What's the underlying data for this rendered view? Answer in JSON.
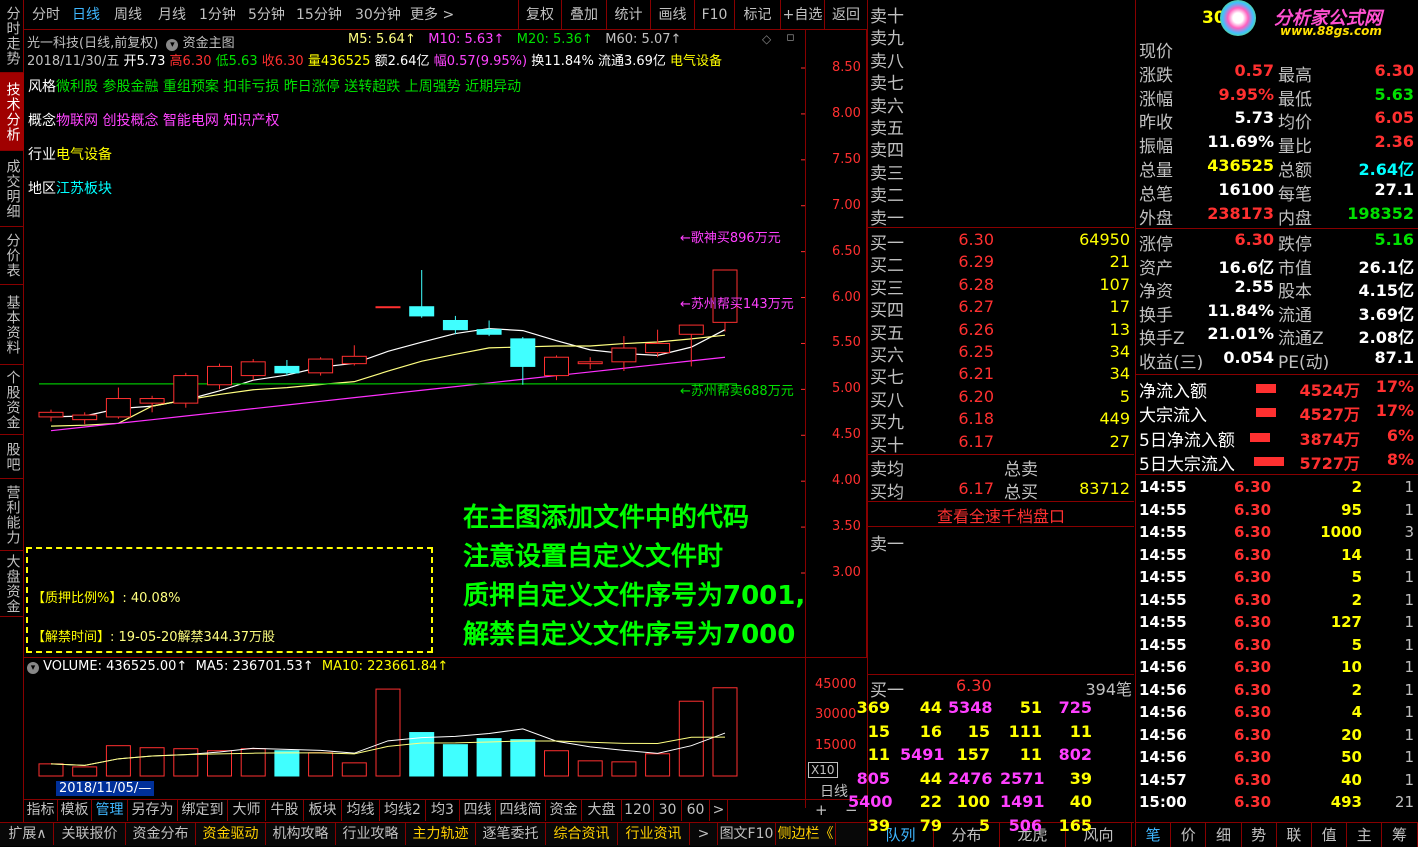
{
  "left_tabs": [
    "分时走势",
    "技术分析",
    "成交明细",
    "分价表",
    "基本资料",
    "个股资金",
    "股吧",
    "营利能力",
    "大盘资金"
  ],
  "period_tabs": [
    "分时",
    "日线",
    "周线",
    "月线",
    "1分钟",
    "5分钟",
    "15分钟",
    "30分钟",
    "更多 >"
  ],
  "toolbar": [
    "复权",
    "叠加",
    "统计",
    "画线",
    "F10",
    "标记",
    "+自选",
    "返回"
  ],
  "header": {
    "title": "光一科技(日线,前复权)",
    "indicator": "资金主图",
    "ma5": "M5: 5.64↑",
    "ma10": "M10: 5.63↑",
    "ma20": "M20: 5.36↑",
    "ma60": "M60: 5.07↑",
    "info_date": "2018/11/30/五",
    "info_open": "开5.73",
    "info_high": "高6.30",
    "info_low": "低5.63",
    "info_close": "收6.30",
    "info_vol": "量436525",
    "info_amt": "额2.64亿",
    "info_chg": "幅0.57(9.95%)",
    "info_turn": "换11.84%",
    "info_float": "流通3.69亿",
    "info_ind": "电气设备"
  },
  "tags": {
    "style_label": "风格",
    "style_value": "微利股 参股金融 重组预案 扣非亏损 昨日涨停 送转超跌 上周强势 近期异动",
    "concept_label": "概念",
    "concept_value": "物联网 创投概念 智能电网 知识产权",
    "industry_label": "行业",
    "industry_value": "电气设备",
    "region_label": "地区",
    "region_value": "江苏板块"
  },
  "price_axis": [
    "8.50",
    "8.00",
    "7.50",
    "7.00",
    "6.50",
    "6.00",
    "5.50",
    "5.00",
    "4.50",
    "4.00",
    "3.50",
    "3.00"
  ],
  "chart_labels": {
    "buy1": "←歌神买896万元",
    "buy2": "←苏州帮买143万元",
    "sell1": "←苏州帮卖688万元"
  },
  "pledge_box": {
    "line1_label": "【质押比例%】",
    "line1_value": ": 40.08%",
    "line2_label": "【解禁时间】",
    "line2_value": ": 19-05-20解禁344.37万股"
  },
  "annotation": [
    "在主图添加文件中的代码",
    "注意设置自定义文件时",
    "质押自定义文件序号为7001,",
    "解禁自定义文件序号为7000"
  ],
  "volume_header": {
    "vol": "VOLUME: 436525.00↑",
    "ma5": "MA5: 236701.53↑",
    "ma10": "MA10: 223661.84↑"
  },
  "volume_axis": [
    "45000",
    "30000",
    "15000"
  ],
  "vol_unit": "X10",
  "date_marker": "2018/11/05/—",
  "bottom_tabs": [
    "指标",
    "模板",
    "管理",
    "另存为",
    "绑定到",
    "大师",
    "牛股",
    "板块",
    "均线",
    "均线2",
    "均3",
    "四线",
    "四线简",
    "资金",
    "大盘",
    "120",
    "30",
    "60",
    ">"
  ],
  "day_label": "日线",
  "bottom_bar": [
    "扩展∧",
    "关联报价",
    "资金分布",
    "资金驱动",
    "机构攻略",
    "行业攻略",
    "主力轨迹",
    "逐笔委托",
    "综合资讯",
    "行业资讯",
    ">",
    "图文F10",
    "侧边栏《"
  ],
  "sells": [
    "卖十",
    "卖九",
    "卖八",
    "卖七",
    "卖六",
    "卖五",
    "卖四",
    "卖三",
    "卖二",
    "卖一"
  ],
  "buys": [
    {
      "l": "买一",
      "p": "6.30",
      "v": "64950"
    },
    {
      "l": "买二",
      "p": "6.29",
      "v": "21"
    },
    {
      "l": "买三",
      "p": "6.28",
      "v": "107"
    },
    {
      "l": "买四",
      "p": "6.27",
      "v": "17"
    },
    {
      "l": "买五",
      "p": "6.26",
      "v": "13"
    },
    {
      "l": "买六",
      "p": "6.25",
      "v": "34"
    },
    {
      "l": "买七",
      "p": "6.21",
      "v": "34"
    },
    {
      "l": "买八",
      "p": "6.20",
      "v": "5"
    },
    {
      "l": "买九",
      "p": "6.18",
      "v": "449"
    },
    {
      "l": "买十",
      "p": "6.17",
      "v": "27"
    }
  ],
  "avg": {
    "sell_avg": "卖均",
    "sell_total": "总卖",
    "buy_avg": "买均",
    "buy_avg_p": "6.17",
    "buy_total": "总买",
    "buy_total_v": "83712"
  },
  "view_all": "查看全速千档盘口",
  "sell1_label": "卖一",
  "buy1_row": {
    "l": "买一",
    "p": "6.30",
    "v": "394笔"
  },
  "queue": [
    [
      "369",
      "44",
      "5348",
      "51",
      "725"
    ],
    [
      "15",
      "16",
      "15",
      "111",
      "11"
    ],
    [
      "11",
      "5491",
      "157",
      "11",
      "802"
    ],
    [
      "805",
      "44",
      "2476",
      "2571",
      "39"
    ],
    [
      "5400",
      "22",
      "100",
      "1491",
      "40"
    ],
    [
      "39",
      "79",
      "5",
      "506",
      "165"
    ]
  ],
  "ob_tabs": [
    "队列",
    "分布",
    "龙虎",
    "风向"
  ],
  "logo": {
    "text": "分析家公式网",
    "url": "www.88gs.com",
    "code": "30"
  },
  "quote": [
    {
      "a": "现价",
      "av": "",
      "b": "",
      "bv": ""
    },
    {
      "a": "涨跌",
      "av": "0.57",
      "b": "最高",
      "bv": "6.30"
    },
    {
      "a": "涨幅",
      "av": "9.95%",
      "b": "最低",
      "bv": "5.63"
    },
    {
      "a": "昨收",
      "av": "5.73",
      "b": "均价",
      "bv": "6.05"
    },
    {
      "a": "振幅",
      "av": "11.69%",
      "b": "量比",
      "bv": "2.36"
    },
    {
      "a": "总量",
      "av": "436525",
      "b": "总额",
      "bv": "2.64亿"
    },
    {
      "a": "总笔",
      "av": "16100",
      "b": "每笔",
      "bv": "27.1"
    },
    {
      "a": "外盘",
      "av": "238173",
      "b": "内盘",
      "bv": "198352"
    }
  ],
  "fund": [
    {
      "a": "涨停",
      "av": "6.30",
      "b": "跌停",
      "bv": "5.16"
    },
    {
      "a": "资产",
      "av": "16.6亿",
      "b": "市值",
      "bv": "26.1亿"
    },
    {
      "a": "净资",
      "av": "2.55",
      "b": "股本",
      "bv": "4.15亿"
    },
    {
      "a": "换手",
      "av": "11.84%",
      "b": "流通",
      "bv": "3.69亿"
    },
    {
      "a": "换手Z",
      "av": "21.01%",
      "b": "流通Z",
      "bv": "2.08亿"
    },
    {
      "a": "收益(三)",
      "av": "0.054",
      "b": "PE(动)",
      "bv": "87.1"
    }
  ],
  "flow": [
    {
      "a": "净流入额",
      "v": "4524万",
      "p": "17%"
    },
    {
      "a": "大宗流入",
      "v": "4527万",
      "p": "17%"
    },
    {
      "a": "5日净流入额",
      "v": "3874万",
      "p": "6%"
    },
    {
      "a": "5日大宗流入",
      "v": "5727万",
      "p": "8%"
    }
  ],
  "ticks": [
    [
      "14:55",
      "6.30",
      "2",
      "1"
    ],
    [
      "14:55",
      "6.30",
      "95",
      "1"
    ],
    [
      "14:55",
      "6.30",
      "1000",
      "3"
    ],
    [
      "14:55",
      "6.30",
      "14",
      "1"
    ],
    [
      "14:55",
      "6.30",
      "5",
      "1"
    ],
    [
      "14:55",
      "6.30",
      "2",
      "1"
    ],
    [
      "14:55",
      "6.30",
      "127",
      "1"
    ],
    [
      "14:55",
      "6.30",
      "5",
      "1"
    ],
    [
      "14:56",
      "6.30",
      "10",
      "1"
    ],
    [
      "14:56",
      "6.30",
      "2",
      "1"
    ],
    [
      "14:56",
      "6.30",
      "4",
      "1"
    ],
    [
      "14:56",
      "6.30",
      "20",
      "1"
    ],
    [
      "14:56",
      "6.30",
      "50",
      "1"
    ],
    [
      "14:57",
      "6.30",
      "40",
      "1"
    ],
    [
      "15:00",
      "6.30",
      "493",
      "21"
    ]
  ],
  "right_tabs": [
    "笔",
    "价",
    "细",
    "势",
    "联",
    "值",
    "主",
    "筹"
  ],
  "chart_data": {
    "type": "candlestick",
    "candles": [
      {
        "o": 4.7,
        "c": 4.75,
        "h": 4.78,
        "l": 4.65
      },
      {
        "o": 4.67,
        "c": 4.72,
        "h": 4.75,
        "l": 4.62
      },
      {
        "o": 4.7,
        "c": 4.9,
        "h": 5.02,
        "l": 4.68
      },
      {
        "o": 4.85,
        "c": 4.9,
        "h": 4.93,
        "l": 4.75
      },
      {
        "o": 4.85,
        "c": 5.15,
        "h": 5.18,
        "l": 4.8
      },
      {
        "o": 5.05,
        "c": 5.25,
        "h": 5.28,
        "l": 5.0
      },
      {
        "o": 5.15,
        "c": 5.3,
        "h": 5.33,
        "l": 5.1
      },
      {
        "o": 5.25,
        "c": 5.18,
        "h": 5.32,
        "l": 5.15
      },
      {
        "o": 5.18,
        "c": 5.33,
        "h": 5.35,
        "l": 5.15
      },
      {
        "o": 5.28,
        "c": 5.36,
        "h": 5.48,
        "l": 5.26
      },
      {
        "o": 5.9,
        "c": 5.9,
        "h": 5.9,
        "l": 5.9
      },
      {
        "o": 5.9,
        "c": 5.8,
        "h": 6.3,
        "l": 5.78
      },
      {
        "o": 5.75,
        "c": 5.65,
        "h": 5.8,
        "l": 5.6
      },
      {
        "o": 5.65,
        "c": 5.6,
        "h": 5.75,
        "l": 5.58
      },
      {
        "o": 5.55,
        "c": 5.25,
        "h": 5.57,
        "l": 5.05
      },
      {
        "o": 5.15,
        "c": 5.35,
        "h": 5.37,
        "l": 5.1
      },
      {
        "o": 5.28,
        "c": 5.3,
        "h": 5.35,
        "l": 5.22
      },
      {
        "o": 5.3,
        "c": 5.45,
        "h": 5.58,
        "l": 5.2
      },
      {
        "o": 5.4,
        "c": 5.5,
        "h": 5.65,
        "l": 5.35
      },
      {
        "o": 5.6,
        "c": 5.7,
        "h": 5.7,
        "l": 5.25
      },
      {
        "o": 5.73,
        "c": 6.3,
        "h": 6.3,
        "l": 5.63
      }
    ],
    "volumes": [
      6000,
      4500,
      15000,
      14000,
      13500,
      12500,
      13500,
      12500,
      11500,
      6500,
      43000,
      21500,
      15500,
      18500,
      18000,
      12500,
      7500,
      7000,
      11000,
      37000,
      43652
    ],
    "ylim": [
      3.0,
      8.5
    ]
  }
}
